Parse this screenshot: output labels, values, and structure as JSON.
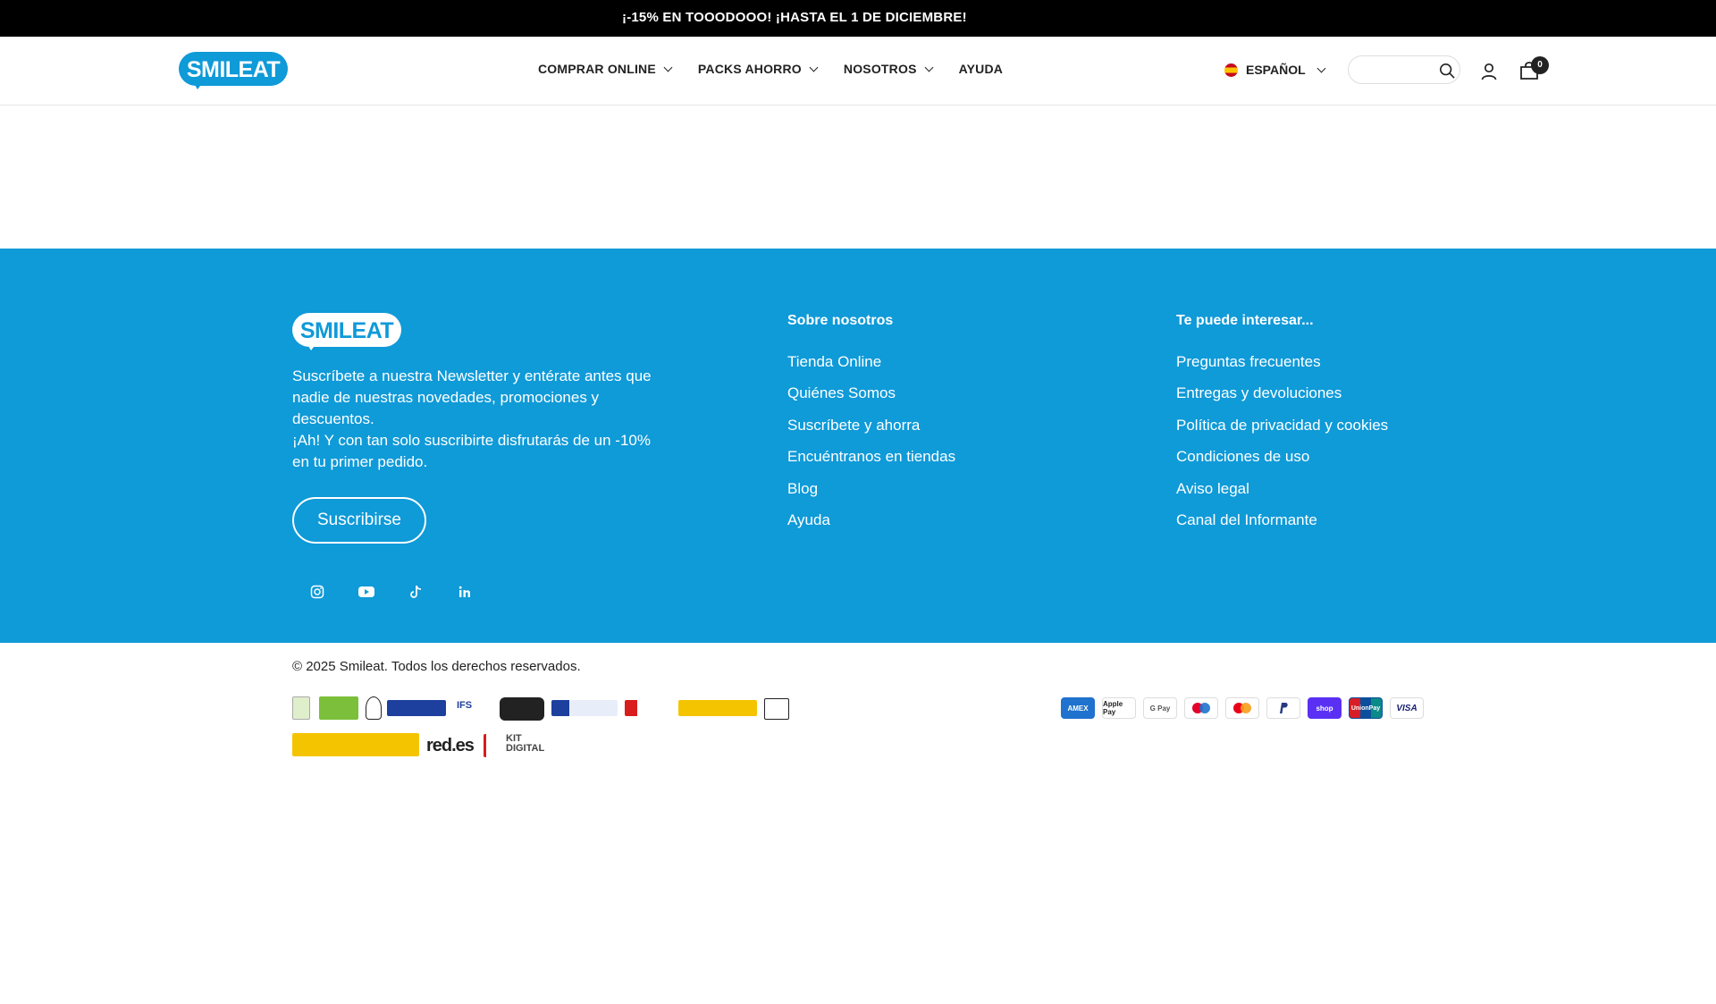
{
  "announcement": {
    "text": "¡-15% EN TOOODOOO! ¡HASTA EL 1 DE DICIEMBRE!"
  },
  "header": {
    "logo_text": "SMILEAT",
    "nav": [
      {
        "label": "COMPRAR ONLINE",
        "has_dropdown": true
      },
      {
        "label": "PACKS AHORRO",
        "has_dropdown": true
      },
      {
        "label": "NOSOTROS",
        "has_dropdown": true
      },
      {
        "label": "AYUDA",
        "has_dropdown": false
      }
    ],
    "language": {
      "label": "ESPAÑOL",
      "flag": "spain-flag-icon"
    },
    "search": {
      "placeholder": ""
    },
    "cart_count": "0"
  },
  "footer": {
    "logo_text": "SMILEAT",
    "newsletter_text_1": "Suscríbete a nuestra Newsletter y entérate antes que nadie de nuestras novedades, promociones y descuentos.",
    "newsletter_text_2": "¡Ah! Y con tan solo suscribirte disfrutarás de un -10% en tu primer pedido.",
    "subscribe_label": "Suscribirse",
    "social": [
      "instagram-icon",
      "youtube-icon",
      "tiktok-icon",
      "linkedin-icon"
    ],
    "columns": [
      {
        "title": "Sobre nosotros",
        "links": [
          "Tienda Online",
          "Quiénes Somos",
          "Suscríbete y ahorra",
          "Encuéntranos en tiendas",
          "Blog",
          "Ayuda"
        ]
      },
      {
        "title": "Te puede interesar...",
        "links": [
          "Preguntas frecuentes",
          "Entregas y devoluciones",
          "Política de privacidad y cookies",
          "Condiciones de uso",
          "Aviso legal",
          "Canal del Informante"
        ]
      }
    ]
  },
  "bottom": {
    "copyright": "© 2025 Smileat. Todos los derechos reservados.",
    "badges": [
      "IFS",
      "red.es",
      "KIT",
      "DIGITAL"
    ],
    "payments": [
      "AMEX",
      "Apple Pay",
      "G Pay",
      "Maestro",
      "Mastercard",
      "PayPal",
      "shop",
      "UnionPay",
      "VISA"
    ]
  },
  "colors": {
    "brand": "#0f9ad8",
    "announcement_bg": "#000000",
    "text": "#222222"
  }
}
